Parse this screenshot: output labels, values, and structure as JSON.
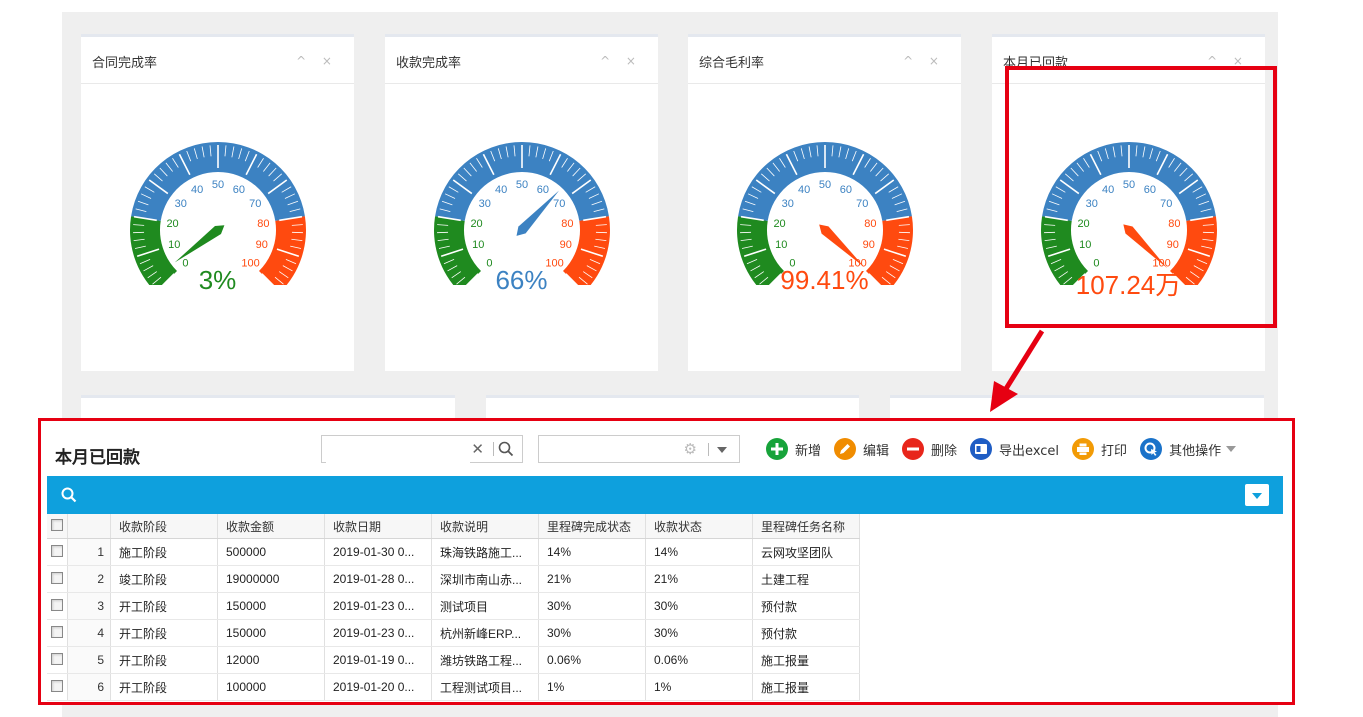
{
  "cards": [
    {
      "title": "合同完成率",
      "value_text": "3%",
      "value": 3,
      "color": "#1f8a1f"
    },
    {
      "title": "收款完成率",
      "value_text": "66%",
      "value": 66,
      "color": "#3c82c2"
    },
    {
      "title": "综合毛利率",
      "value_text": "99.41%",
      "value": 99.41,
      "color": "#ff4a0f"
    },
    {
      "title": "本月已回款",
      "value_text": "107.24万",
      "value": 100,
      "color": "#ff4a0f"
    }
  ],
  "card_tools": "^ ×",
  "gauge_ticks": [
    "0",
    "10",
    "20",
    "30",
    "40",
    "50",
    "60",
    "70",
    "80",
    "90",
    "100"
  ],
  "colors": {
    "green": "#1f8a1f",
    "blue": "#3c82c2",
    "red": "#ff4a0f",
    "accent": "#0ea0dd",
    "highlight": "#e60012"
  },
  "panel": {
    "title": "本月已回款",
    "search_placeholder": "",
    "select_value": "",
    "toolbar": [
      {
        "label": "新增",
        "icon": "plus-icon",
        "color": "#17a33a"
      },
      {
        "label": "编辑",
        "icon": "pencil-icon",
        "color": "#f08c00"
      },
      {
        "label": "删除",
        "icon": "minus-icon",
        "color": "#e8261b"
      },
      {
        "label": "导出excel",
        "icon": "excel-icon",
        "color": "#1f5dc4"
      },
      {
        "label": "打印",
        "icon": "printer-icon",
        "color": "#f29b06"
      },
      {
        "label": "其他操作",
        "icon": "cursor-icon",
        "color": "#1a72c9"
      }
    ],
    "columns": [
      "收款阶段",
      "收款金额",
      "收款日期",
      "收款说明",
      "里程碑完成状态",
      "收款状态",
      "里程碑任务名称"
    ],
    "rows": [
      [
        "1",
        "施工阶段",
        "500000",
        "2019-01-30 0...",
        "珠海铁路施工...",
        "14%",
        "14%",
        "云网攻坚团队"
      ],
      [
        "2",
        "竣工阶段",
        "19000000",
        "2019-01-28 0...",
        "深圳市南山赤...",
        "21%",
        "21%",
        "土建工程"
      ],
      [
        "3",
        "开工阶段",
        "150000",
        "2019-01-23 0...",
        "测试项目",
        "30%",
        "30%",
        "预付款"
      ],
      [
        "4",
        "开工阶段",
        "150000",
        "2019-01-23 0...",
        "杭州新峰ERP...",
        "30%",
        "30%",
        "预付款"
      ],
      [
        "5",
        "开工阶段",
        "12000",
        "2019-01-19 0...",
        "潍坊铁路工程...",
        "0.06%",
        "0.06%",
        "施工报量"
      ],
      [
        "6",
        "开工阶段",
        "100000",
        "2019-01-20 0...",
        "工程测试项目...",
        "1%",
        "1%",
        "施工报量"
      ]
    ]
  }
}
